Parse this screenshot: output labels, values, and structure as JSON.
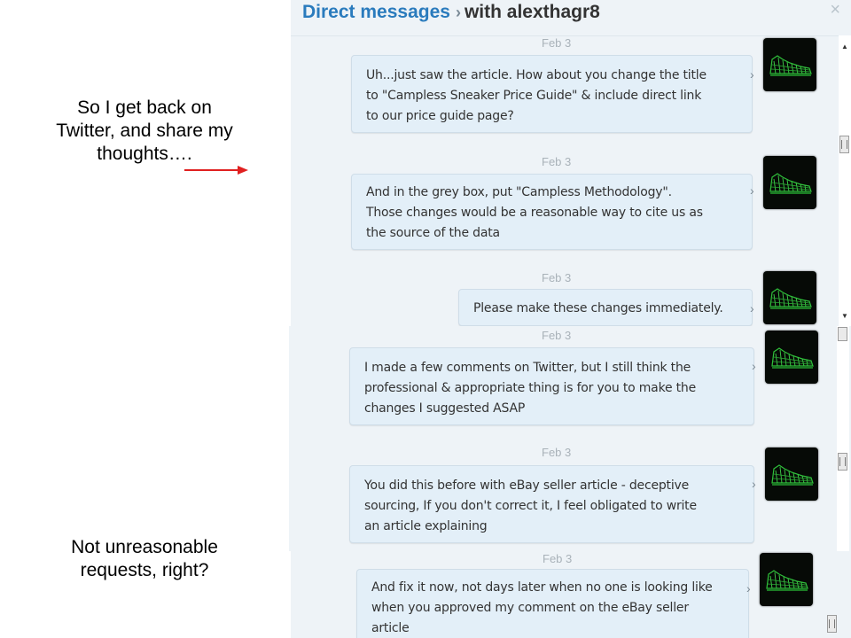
{
  "annotations": {
    "top": [
      "So I get back on",
      "Twitter, and share my",
      "thoughts…."
    ],
    "bottom": [
      "Not unreasonable",
      "requests, right?"
    ]
  },
  "header": {
    "title": "Direct messages",
    "separator": "›",
    "with_user": "with alexthagr8",
    "close": "×"
  },
  "messages": [
    {
      "date": "Feb 3",
      "lines": [
        "Uh...just saw the article. How about you change the title",
        "to \"Campless Sneaker Price Guide\" & include direct link",
        "to our price guide page?"
      ]
    },
    {
      "date": "Feb 3",
      "lines": [
        "And in the grey box, put \"Campless Methodology\".",
        "Those changes would be a reasonable way to cite us as",
        "the source of the data"
      ]
    },
    {
      "date": "Feb 3",
      "lines": [
        "Please make these changes immediately."
      ]
    },
    {
      "date": "Feb 3",
      "lines": [
        "I made a few comments on Twitter, but I still think the",
        "professional & appropriate thing is for you to make the",
        "changes I suggested ASAP"
      ]
    },
    {
      "date": "Feb 3",
      "lines": [
        "You did this before with eBay seller article - deceptive",
        "sourcing, If you don't correct it, I feel obligated to write",
        "an article explaining"
      ]
    },
    {
      "date": "Feb 3",
      "lines": [
        "And fix it now, not days later when no one is looking like",
        "when you approved my comment on the eBay seller",
        "article"
      ]
    }
  ],
  "colors": {
    "title_blue": "#2a7bbd",
    "panel_bg": "#eef3f7",
    "bubble_bg": "#e3eff8",
    "arrow_red": "#e02020"
  },
  "icons": {
    "avatar": "green-sneaker-avatar",
    "chevron": "chevron-right-icon",
    "close": "close-icon",
    "scroll": "scrollbar-thumb"
  }
}
